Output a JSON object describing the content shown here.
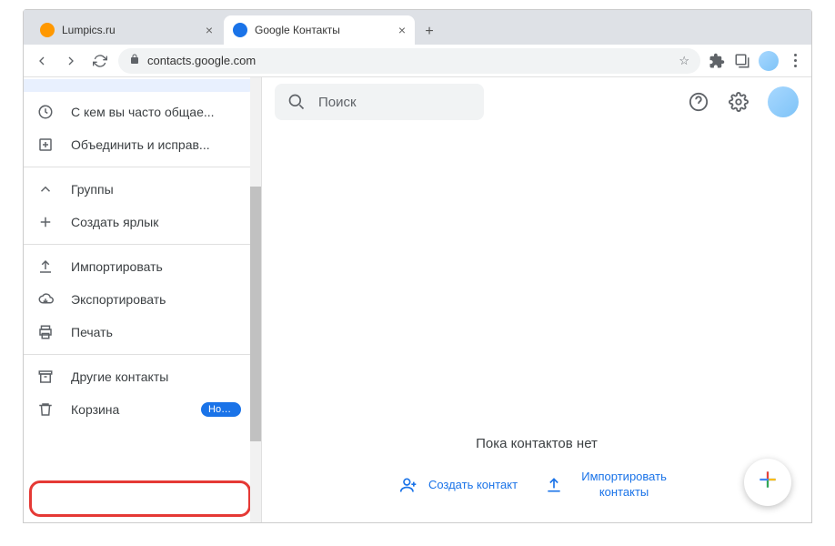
{
  "window": {
    "minimize": "—",
    "maximize": "□",
    "close": "✕"
  },
  "tabs": [
    {
      "title": "Lumpics.ru",
      "favicon_color": "#ff9800"
    },
    {
      "title": "Google Контакты",
      "favicon_color": "#1a73e8"
    }
  ],
  "address_bar": {
    "url": "contacts.google.com"
  },
  "sidebar": {
    "frequent": "С кем вы часто общае...",
    "merge_fix": "Объединить и исправ...",
    "groups": "Группы",
    "create_label": "Создать ярлык",
    "import": "Импортировать",
    "export": "Экспортировать",
    "print": "Печать",
    "other_contacts": "Другие контакты",
    "trash": "Корзина",
    "trash_badge": "Нови..."
  },
  "search": {
    "placeholder": "Поиск"
  },
  "empty": {
    "text": "Пока контактов нет",
    "create": "Создать контакт",
    "import": "Импортировать контакты"
  }
}
